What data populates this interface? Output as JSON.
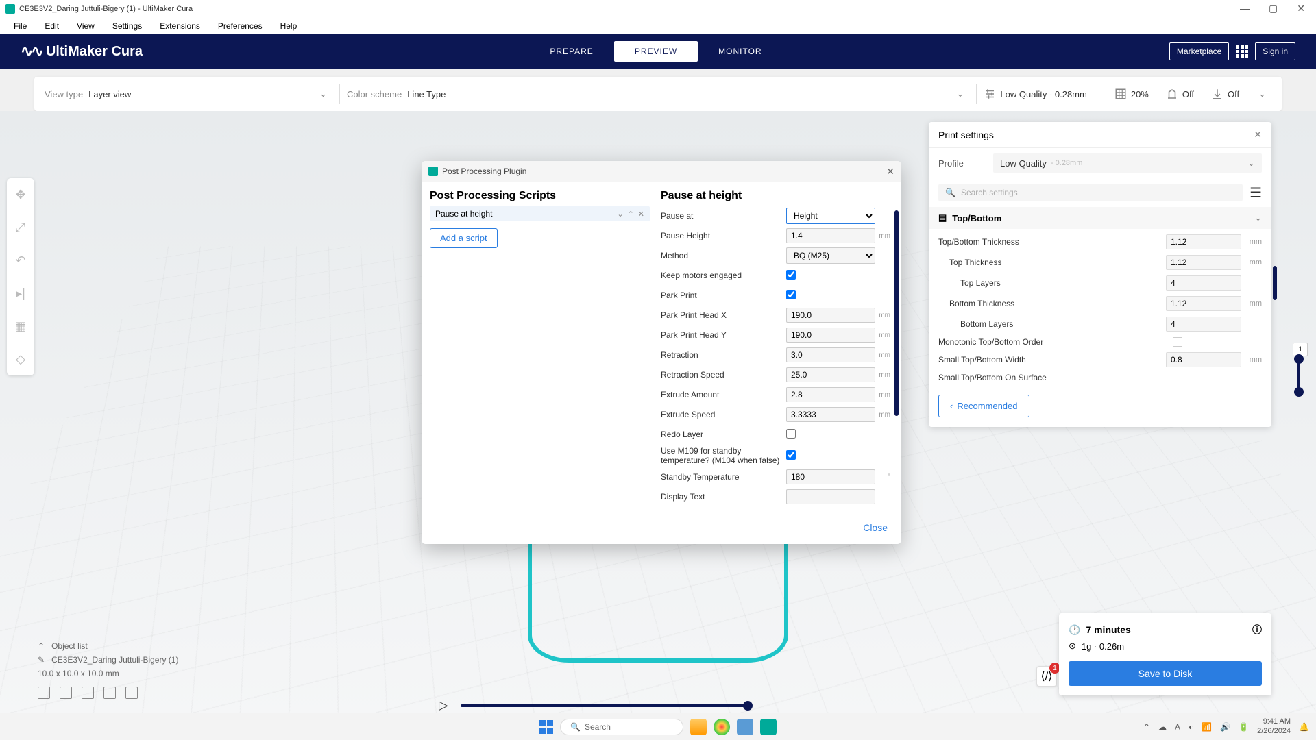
{
  "window": {
    "title": "CE3E3V2_Daring Juttuli-Bigery (1) - UltiMaker Cura"
  },
  "menu": [
    "File",
    "Edit",
    "View",
    "Settings",
    "Extensions",
    "Preferences",
    "Help"
  ],
  "brand": "UltiMaker Cura",
  "tabs": {
    "prepare": "PREPARE",
    "preview": "PREVIEW",
    "monitor": "MONITOR"
  },
  "marketplace": "Marketplace",
  "signin": "Sign in",
  "viewbar": {
    "viewtype_label": "View type",
    "viewtype_value": "Layer view",
    "colorscheme_label": "Color scheme",
    "colorscheme_value": "Line Type",
    "quality": "Low Quality - 0.28mm",
    "infill": "20%",
    "support": "Off",
    "adhesion": "Off"
  },
  "modal": {
    "title": "Post Processing Plugin",
    "left_heading": "Post Processing Scripts",
    "script_name": "Pause at height",
    "add_script": "Add a script",
    "right_heading": "Pause at height",
    "close": "Close",
    "fields": {
      "pause_at_label": "Pause at",
      "pause_at_value": "Height",
      "pause_height_label": "Pause Height",
      "pause_height_value": "1.4",
      "pause_height_unit": "mm",
      "method_label": "Method",
      "method_value": "BQ (M25)",
      "keep_motors_label": "Keep motors engaged",
      "park_print_label": "Park Print",
      "park_x_label": "Park Print Head X",
      "park_x_value": "190.0",
      "park_x_unit": "mm",
      "park_y_label": "Park Print Head Y",
      "park_y_value": "190.0",
      "park_y_unit": "mm",
      "retraction_label": "Retraction",
      "retraction_value": "3.0",
      "retraction_unit": "mm",
      "retraction_speed_label": "Retraction Speed",
      "retraction_speed_value": "25.0",
      "retraction_speed_unit": "mm",
      "extrude_amount_label": "Extrude Amount",
      "extrude_amount_value": "2.8",
      "extrude_amount_unit": "mm",
      "extrude_speed_label": "Extrude Speed",
      "extrude_speed_value": "3.3333",
      "extrude_speed_unit": "mm",
      "redo_layer_label": "Redo Layer",
      "m109_label": "Use M109 for standby temperature? (M104 when false)",
      "standby_temp_label": "Standby Temperature",
      "standby_temp_value": "180",
      "standby_temp_unit": "°",
      "display_text_label": "Display Text",
      "display_text_value": ""
    }
  },
  "panel": {
    "title": "Print settings",
    "profile_label": "Profile",
    "profile_value": "Low Quality",
    "profile_dim": "- 0.28mm",
    "search_placeholder": "Search settings",
    "section": "Top/Bottom",
    "rows": {
      "tb_thickness": {
        "l": "Top/Bottom Thickness",
        "v": "1.12",
        "u": "mm"
      },
      "top_thickness": {
        "l": "Top Thickness",
        "v": "1.12",
        "u": "mm"
      },
      "top_layers": {
        "l": "Top Layers",
        "v": "4",
        "u": ""
      },
      "bottom_thickness": {
        "l": "Bottom Thickness",
        "v": "1.12",
        "u": "mm"
      },
      "bottom_layers": {
        "l": "Bottom Layers",
        "v": "4",
        "u": ""
      },
      "monotonic": {
        "l": "Monotonic Top/Bottom Order"
      },
      "small_width": {
        "l": "Small Top/Bottom Width",
        "v": "0.8",
        "u": "mm"
      },
      "small_surface": {
        "l": "Small Top/Bottom On Surface"
      }
    },
    "recommended": "Recommended"
  },
  "object": {
    "list_label": "Object list",
    "name": "CE3E3V2_Daring Juttuli-Bigery (1)",
    "dims": "10.0 x 10.0 x 10.0 mm"
  },
  "time": {
    "duration": "7 minutes",
    "material": "1g · 0.26m",
    "save": "Save to Disk",
    "badge": "1"
  },
  "vslider_value": "1",
  "taskbar": {
    "search": "Search",
    "time": "9:41 AM",
    "date": "2/26/2024"
  }
}
